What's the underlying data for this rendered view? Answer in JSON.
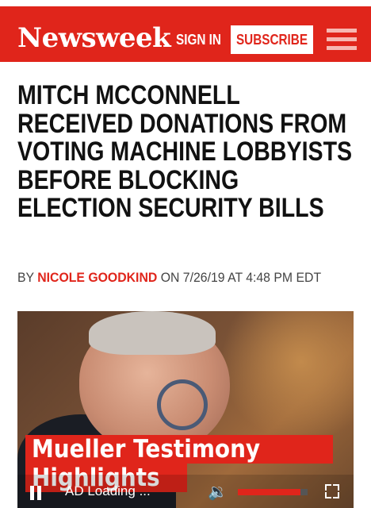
{
  "header": {
    "logo": "Newsweek",
    "sign_in": "SIGN IN",
    "subscribe": "SUBSCRIBE",
    "menu_icon": "hamburger-menu-icon",
    "brand_color": "#e0251b"
  },
  "article": {
    "headline": "MITCH MCCONNELL RECEIVED DONATIONS FROM VOTING MACHINE LOBBYISTS BEFORE BLOCKING ELECTION SECURITY BILLS",
    "byline_prefix": "BY",
    "author": "NICOLE GOODKIND",
    "date_text": "ON 7/26/19 AT 4:48 PM EDT"
  },
  "video": {
    "caption_line1": "Mueller Testimony",
    "caption_line2": "Highlights",
    "status": "AD Loading ...",
    "pause_icon": "pause-icon",
    "volume_icon": "volume-icon",
    "fullscreen_icon": "fullscreen-icon",
    "progress": 0.9
  }
}
